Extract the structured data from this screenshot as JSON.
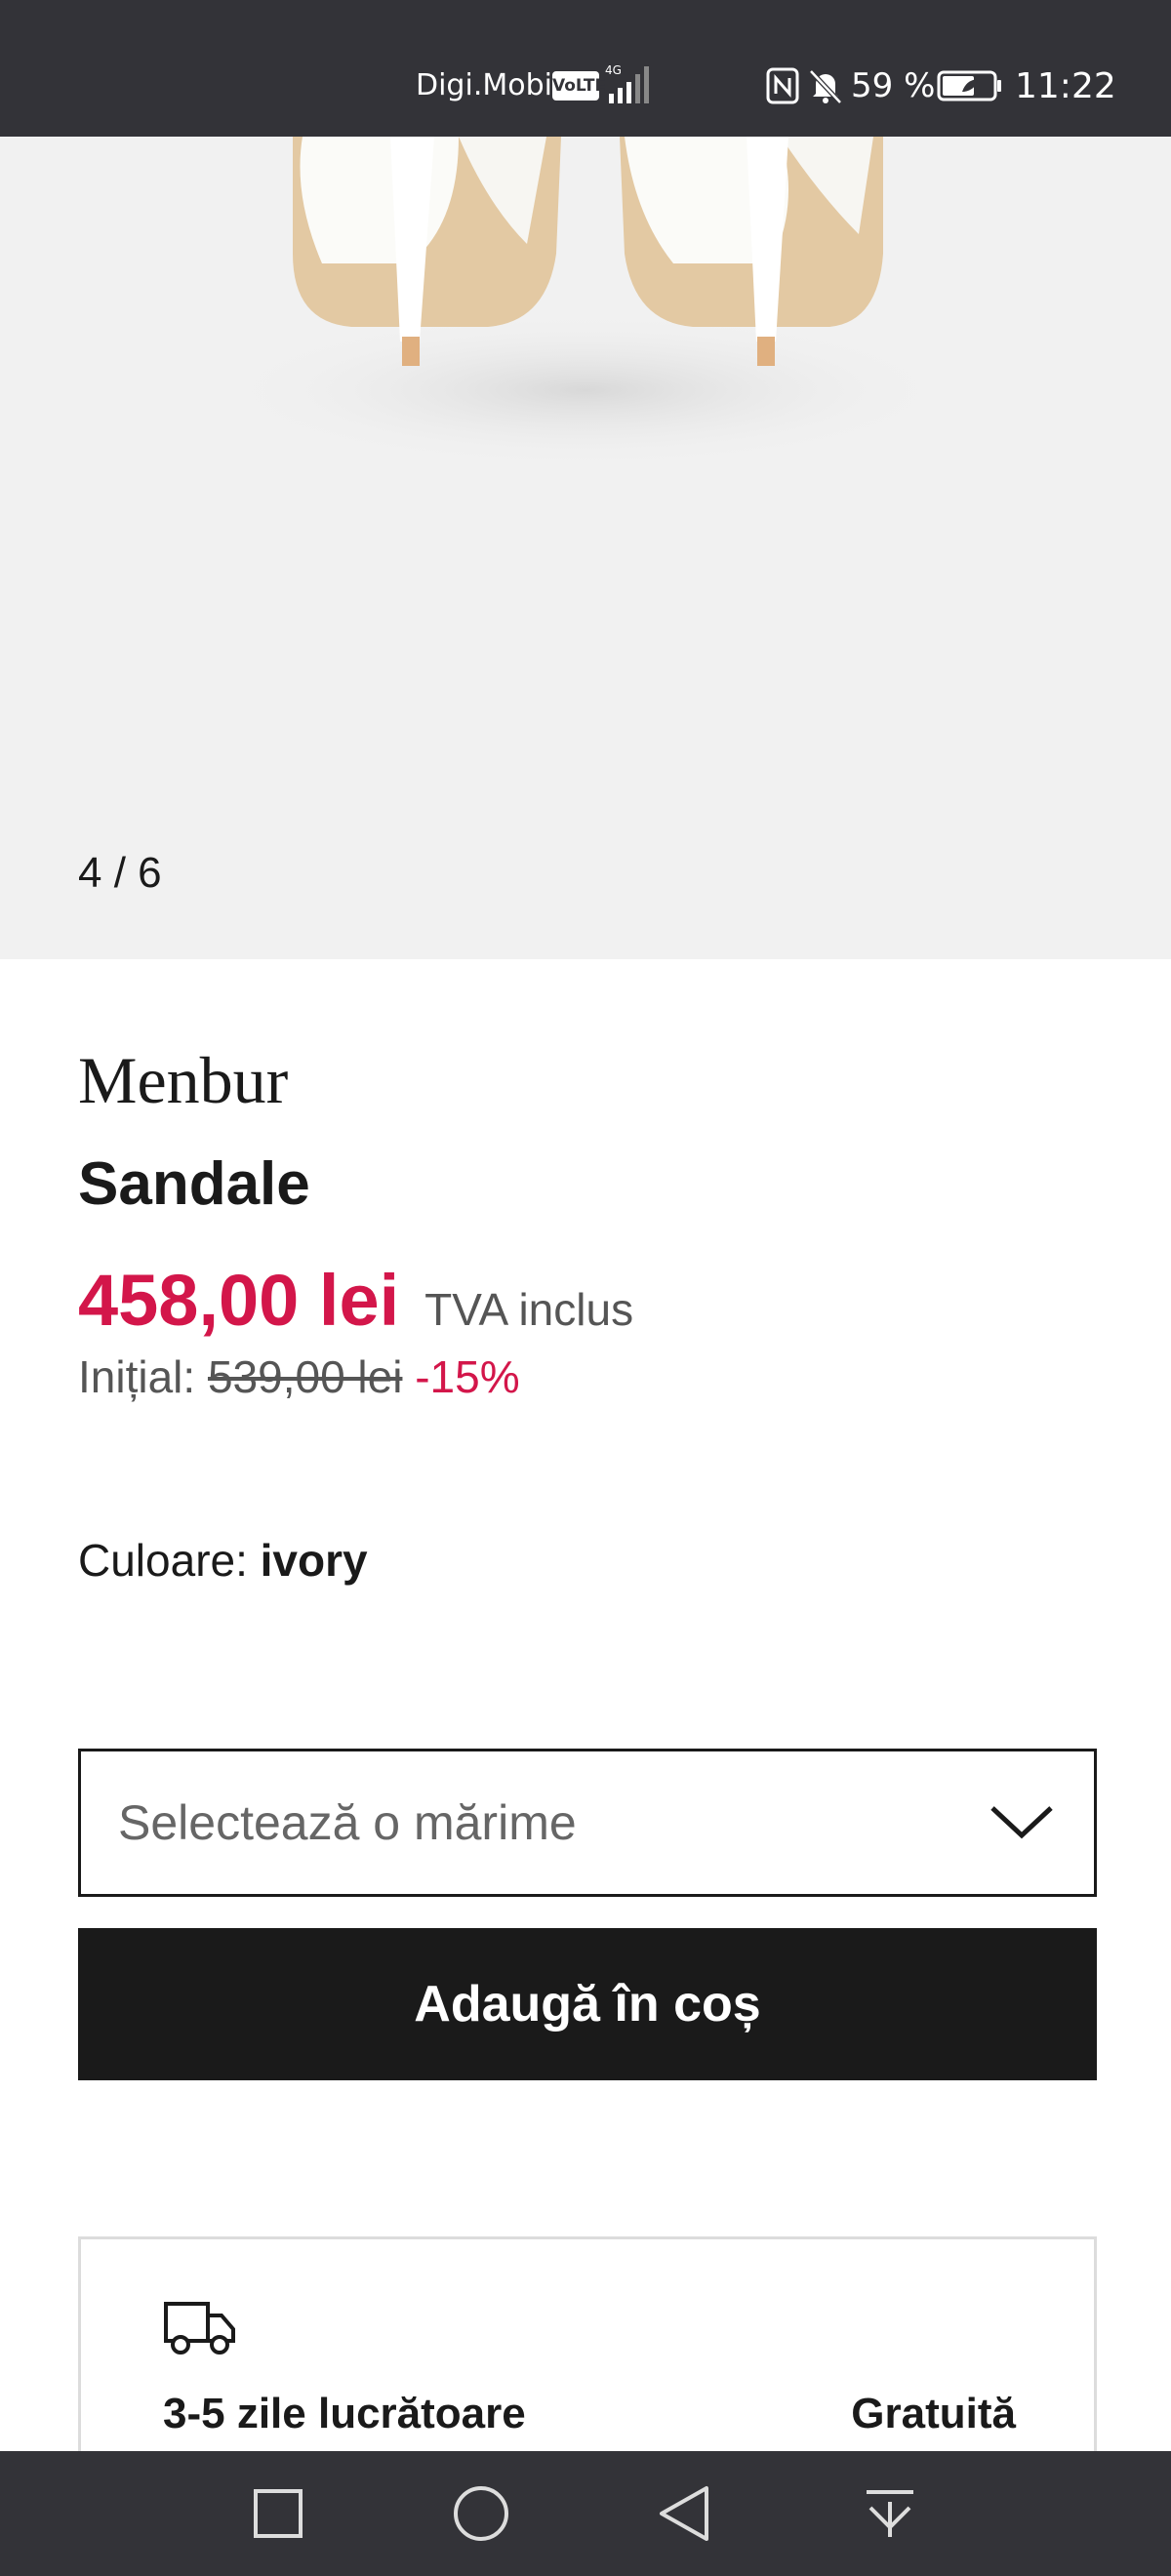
{
  "status_bar": {
    "carrier": "Digi.Mobil",
    "volte": "VoLTE",
    "network": "4G",
    "battery_percent": "59 %",
    "time": "11:22",
    "icons": [
      "signal-icon",
      "nfc-icon",
      "bell-off-icon",
      "battery-icon"
    ]
  },
  "gallery": {
    "counter": "4 / 6",
    "current": 4,
    "total": 6
  },
  "product": {
    "brand": "Menbur",
    "name": "Sandale",
    "price": "458,00 lei",
    "vat_note": "TVA inclus",
    "initial_label": "Inițial:",
    "initial_price": "539,00 lei",
    "discount": "-15%",
    "color_label": "Culoare:",
    "color_value": "ivory"
  },
  "size_select": {
    "placeholder": "Selectează o mărime",
    "icon": "chevron-down-icon"
  },
  "actions": {
    "add_to_cart": "Adaugă în coș"
  },
  "delivery": {
    "icon": "truck-icon",
    "time": "3-5 zile lucrătoare",
    "cost": "Gratuită"
  },
  "nav_bar": {
    "buttons": [
      "recents-square-icon",
      "home-circle-icon",
      "back-triangle-icon",
      "notifications-down-icon"
    ]
  },
  "colors": {
    "accent_price": "#d3164a",
    "button_bg": "#1a1a1a",
    "system_bar": "#333338",
    "image_bg": "#f1f1f1"
  }
}
